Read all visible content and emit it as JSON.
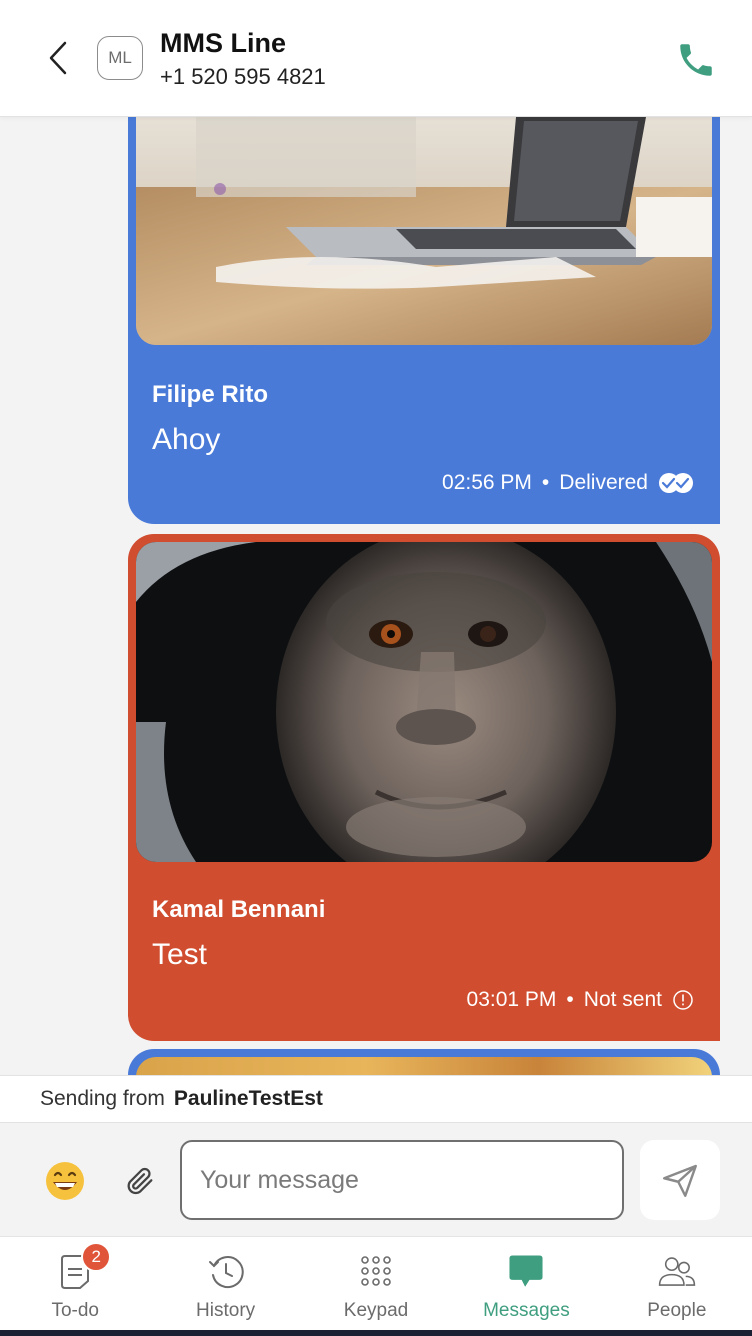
{
  "header": {
    "back_icon": "chevron-left-icon",
    "avatar_initials": "ML",
    "title": "MMS Line",
    "phone": "+1 520 595 4821",
    "call_icon": "phone-icon",
    "call_color": "#3f9e80"
  },
  "messages": [
    {
      "sender": "Filipe Rito",
      "text": "Ahoy",
      "time": "02:56 PM",
      "separator": "•",
      "status": "Delivered",
      "status_icon": "double-check-icon",
      "color": "#4a7ad8",
      "image": "laptop-on-desk-photo"
    },
    {
      "sender": "Kamal Bennani",
      "text": "Test",
      "time": "03:01 PM",
      "separator": "•",
      "status": "Not sent",
      "status_icon": "error-info-icon",
      "color": "#d04d2f",
      "image": "monkey-astronaut-photo"
    }
  ],
  "sending": {
    "label": "Sending from",
    "account": "PaulineTestEst"
  },
  "composer": {
    "placeholder": "Your message",
    "emoji_icon": "grinning-emoji-icon",
    "attach_icon": "paperclip-icon",
    "send_icon": "paper-plane-icon"
  },
  "nav": {
    "items": [
      {
        "label": "To-do",
        "icon": "todo-icon",
        "badge": "2"
      },
      {
        "label": "History",
        "icon": "history-icon"
      },
      {
        "label": "Keypad",
        "icon": "keypad-icon"
      },
      {
        "label": "Messages",
        "icon": "messages-icon",
        "active": true
      },
      {
        "label": "People",
        "icon": "people-icon"
      }
    ],
    "active_color": "#3f9e80"
  }
}
